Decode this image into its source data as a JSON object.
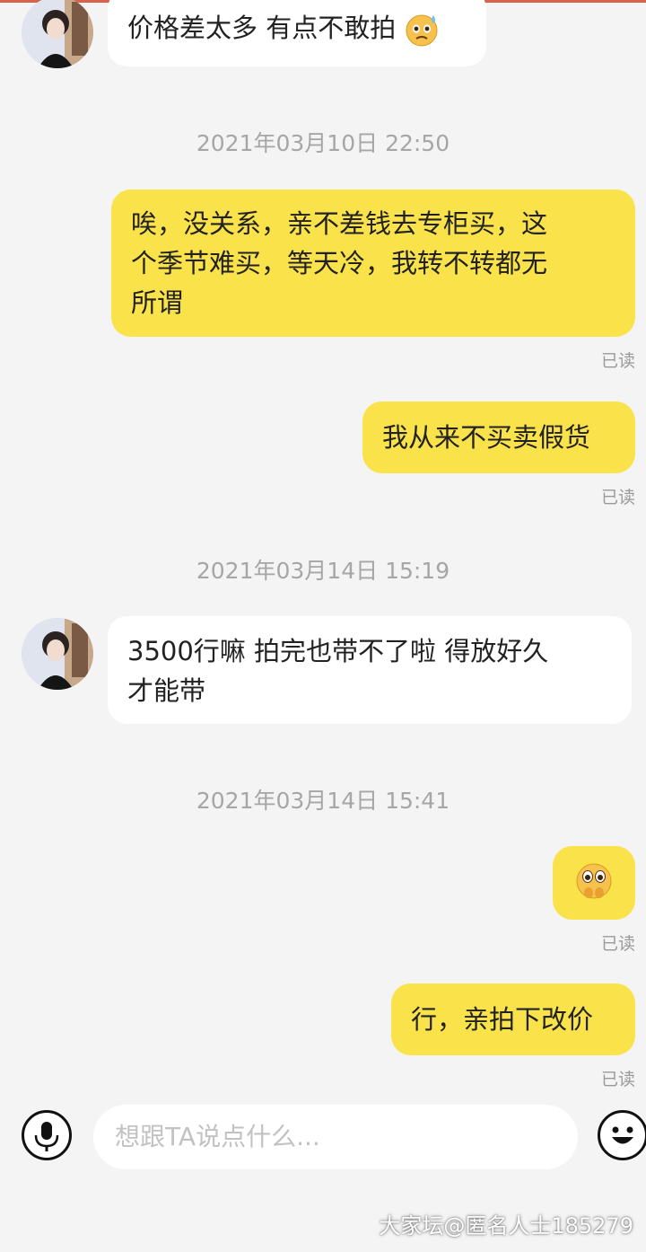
{
  "messages": [
    {
      "type": "incoming",
      "text": "价格差太多 有点不敢拍",
      "emoji": "anxious-face-with-sweat"
    },
    {
      "type": "timestamp",
      "text": "2021年03月10日 22:50"
    },
    {
      "type": "outgoing",
      "lines": [
        "唉，没关系，亲不差钱去专柜买，这",
        "个季节难买，等天冷，我转不转都无",
        "所谓"
      ],
      "status": "已读"
    },
    {
      "type": "outgoing",
      "text": "我从来不买卖假货",
      "status": "已读"
    },
    {
      "type": "timestamp",
      "text": "2021年03月14日 15:19"
    },
    {
      "type": "incoming",
      "lines": [
        "3500行嘛 拍完也带不了啦 得放好久",
        "才能带"
      ]
    },
    {
      "type": "timestamp",
      "text": "2021年03月14日 15:41"
    },
    {
      "type": "outgoing",
      "emoji": "pleading-face-with-hands",
      "status": "已读"
    },
    {
      "type": "outgoing",
      "text": "行，亲拍下改价",
      "status": "已读"
    }
  ],
  "input": {
    "placeholder": "想跟TA说点什么..."
  },
  "watermark": "大家坛@匿名人士185279",
  "colors": {
    "outgoing_bubble": "#f9e24a",
    "incoming_bubble": "#ffffff",
    "background": "#f4f4f4"
  }
}
